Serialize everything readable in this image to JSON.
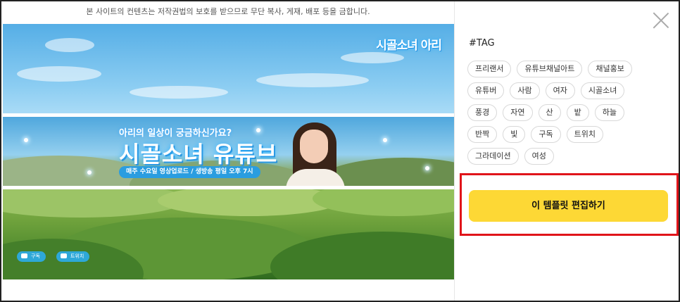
{
  "notice": "본 사이트의 컨텐츠는 저작권법의 보호를 받으므로 무단 복사, 게재, 배포 등을 금합니다.",
  "banners": {
    "top_logo": "시골소녀 아리",
    "middle_subtitle": "아리의 일상이 궁금하신가요?",
    "middle_title": "시골소녀 유튜브",
    "middle_pill": "매주 수요일 영상업로드 / 생방송 평일 오후 7시",
    "bottom_subscribe": "구독",
    "bottom_twitch": "트위치"
  },
  "panel": {
    "tag_heading": "#TAG",
    "tags": [
      "프리랜서",
      "유튜브채널아트",
      "채널홍보",
      "유튜버",
      "사람",
      "여자",
      "시골소녀",
      "풍경",
      "자연",
      "산",
      "밭",
      "하늘",
      "반짝",
      "빛",
      "구독",
      "트위치",
      "그라데이션",
      "여성"
    ],
    "edit_button": "이 템플릿 편집하기"
  },
  "colors": {
    "button_bg": "#fdd835",
    "highlight_border": "#e0141a",
    "sky": "#55aee6",
    "field": "#6fa23c"
  },
  "icons": {
    "close": "close-icon",
    "youtube": "youtube-icon",
    "twitch": "twitch-icon"
  }
}
